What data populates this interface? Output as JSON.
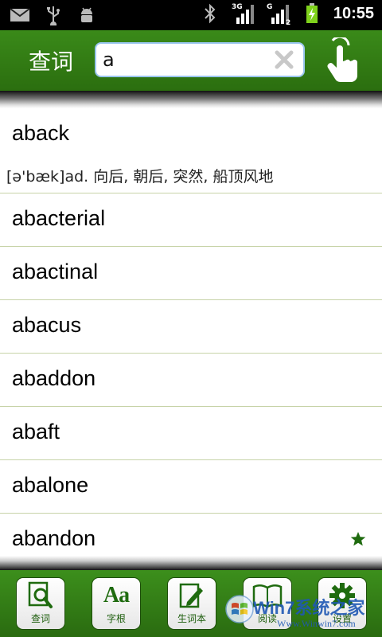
{
  "status_bar": {
    "time": "10:55",
    "net1": "3G",
    "net2": "G",
    "net2_sub": "2"
  },
  "header": {
    "title": "查词",
    "search_value": "a"
  },
  "list": {
    "items": [
      {
        "word": "aback",
        "definition": "[ə'bæk]ad. 向后, 朝后, 突然, 船顶风地"
      },
      {
        "word": "abacterial"
      },
      {
        "word": "abactinal"
      },
      {
        "word": "abacus"
      },
      {
        "word": "abaddon"
      },
      {
        "word": "abaft"
      },
      {
        "word": "abalone"
      },
      {
        "word": "abandon"
      }
    ]
  },
  "toolbar": {
    "lookup": "查词",
    "root": "字根",
    "root_icon_text": "Aa",
    "wordbook": "生词本",
    "read": "阅读",
    "settings": "设置"
  },
  "watermark": {
    "main": "Win7系统之家",
    "sub": "Www.Winwin7.com"
  },
  "colors": {
    "header_green": "#2f7a12",
    "accent_green": "#1f6b0f",
    "divider": "#c7d3a8"
  }
}
